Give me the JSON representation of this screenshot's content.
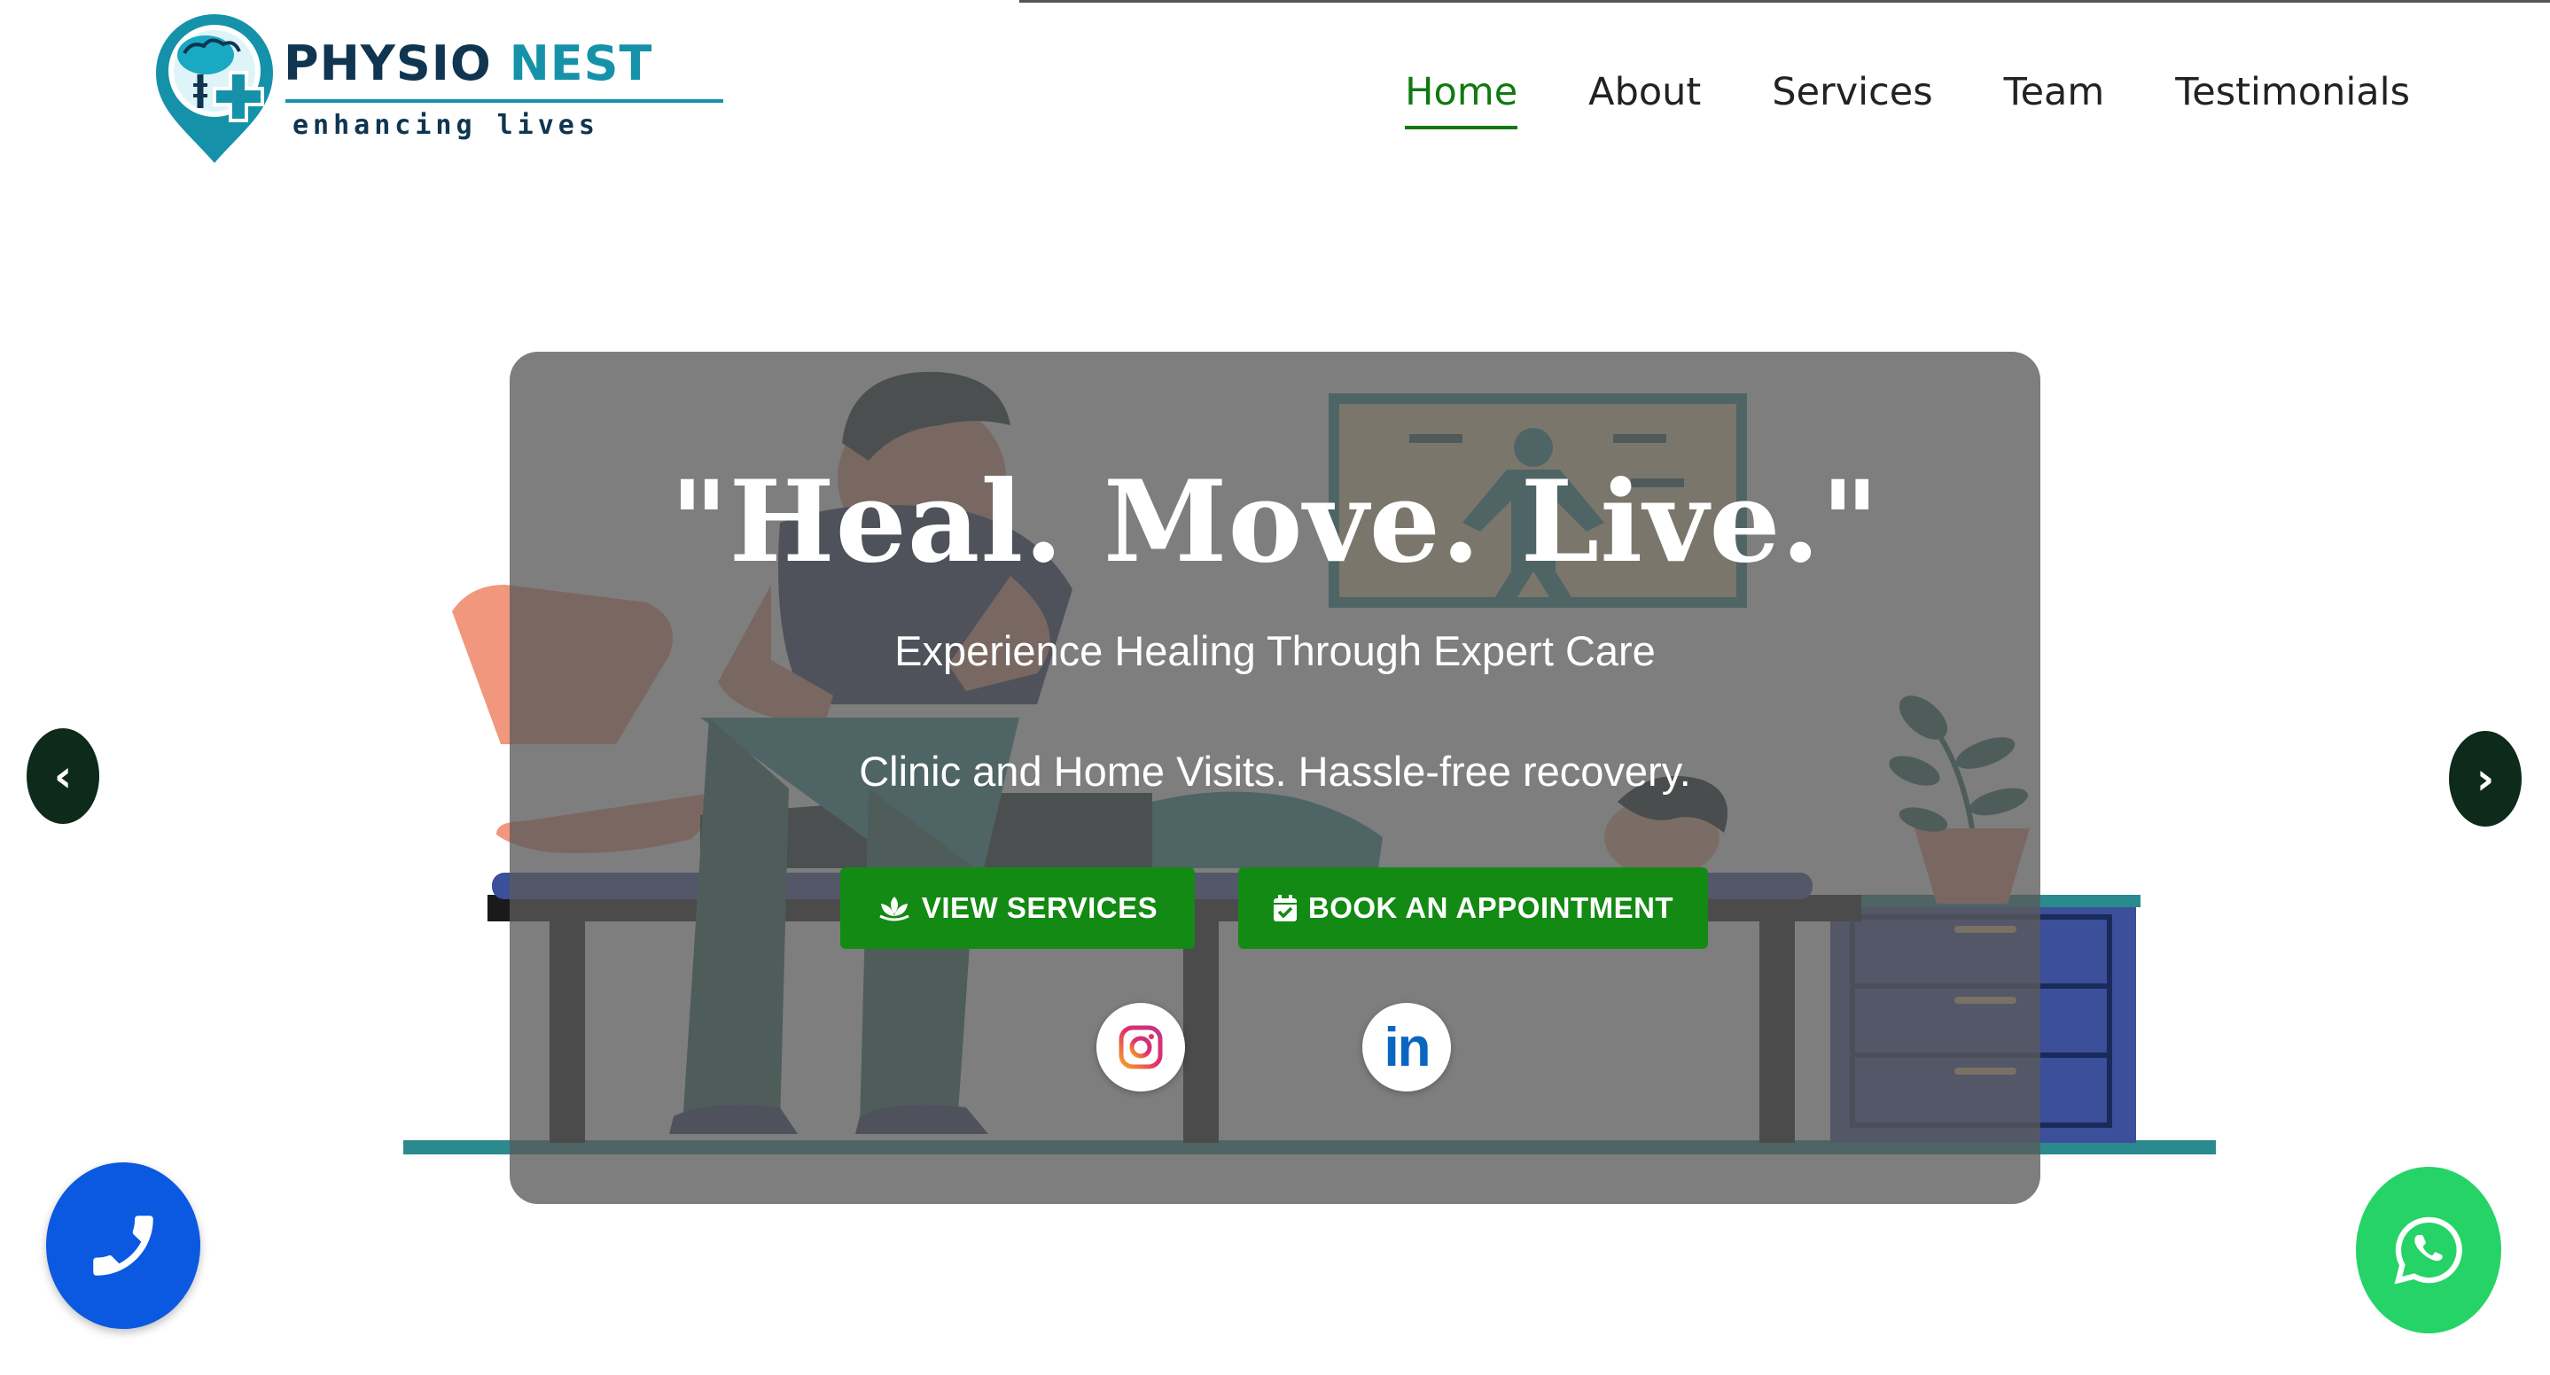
{
  "brand": {
    "name_part1": "PHYSIO",
    "name_part2": "NEST",
    "tagline": "enhancing lives",
    "logo_icon": "brain-pin-logo",
    "colors": {
      "dark": "#0f3550",
      "teal": "#1592a9"
    }
  },
  "nav": {
    "items": [
      {
        "label": "Home",
        "active": true
      },
      {
        "label": "About",
        "active": false
      },
      {
        "label": "Services",
        "active": false
      },
      {
        "label": "Team",
        "active": false
      },
      {
        "label": "Testimonials",
        "active": false
      }
    ],
    "active_color": "#0f7a0f"
  },
  "hero": {
    "headline": "\"Heal. Move. Live.\"",
    "subtitle": "Experience Healing Through Expert Care",
    "subtitle2": "Clinic and Home Visits. Hassle-free recovery.",
    "illustration": "physiotherapist-treating-patient",
    "buttons": {
      "services_label": "VIEW SERVICES",
      "services_icon": "lotus-icon",
      "appointment_label": "BOOK AN APPOINTMENT",
      "appointment_icon": "calendar-check-icon",
      "color": "#138a13"
    },
    "social": [
      {
        "name": "instagram-icon"
      },
      {
        "name": "linkedin-icon",
        "glyph": "in"
      }
    ]
  },
  "carousel": {
    "prev_glyph": "‹",
    "next_glyph": "›"
  },
  "floating": {
    "phone_icon": "phone-icon",
    "phone_color": "#0a59e0",
    "whatsapp_icon": "whatsapp-icon",
    "whatsapp_color": "#25d366"
  }
}
